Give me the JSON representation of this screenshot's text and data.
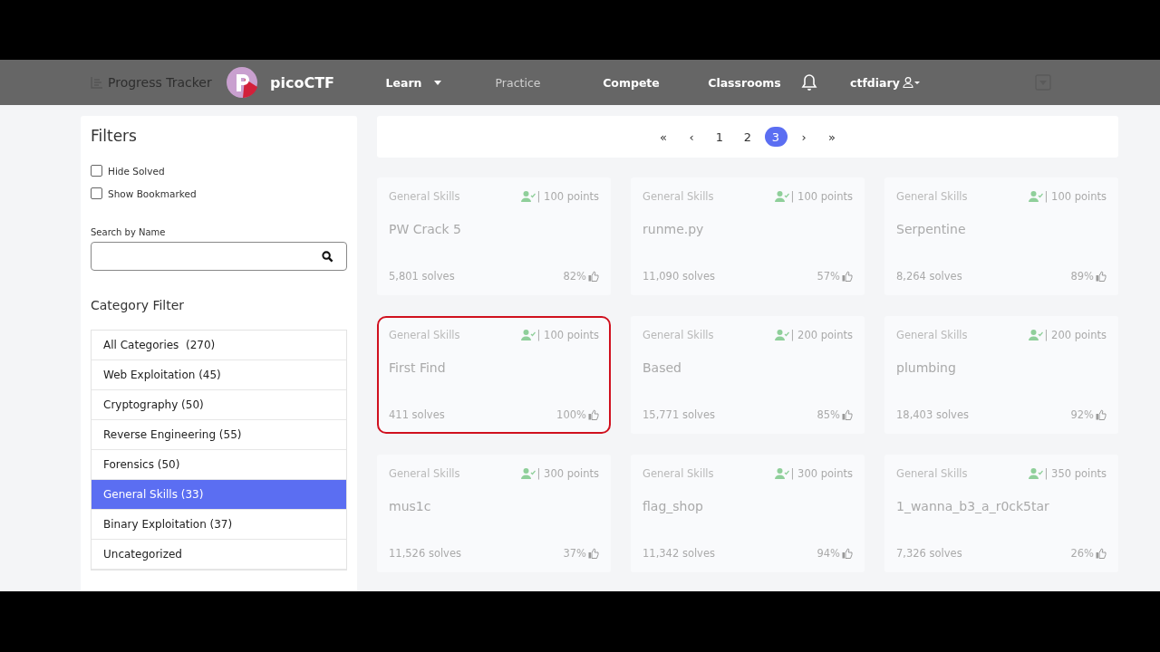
{
  "header": {
    "progress_tracker": "Progress Tracker",
    "brand": "picoCTF",
    "nav": [
      {
        "label": "Learn",
        "dropdown": true,
        "selected": false
      },
      {
        "label": "Practice",
        "dropdown": false,
        "selected": true
      },
      {
        "label": "Compete",
        "dropdown": false,
        "selected": false
      },
      {
        "label": "Classrooms",
        "dropdown": false,
        "selected": false
      }
    ],
    "user": "ctfdiary"
  },
  "filters": {
    "title": "Filters",
    "checkboxes": [
      {
        "label": "Hide Solved",
        "checked": false
      },
      {
        "label": "Show Bookmarked",
        "checked": false
      }
    ],
    "search_label": "Search by Name",
    "category_title": "Category Filter",
    "categories": [
      {
        "label": "All Categories  (270)",
        "selected": false
      },
      {
        "label": "Web Exploitation (45)",
        "selected": false
      },
      {
        "label": "Cryptography (50)",
        "selected": false
      },
      {
        "label": "Reverse Engineering (55)",
        "selected": false
      },
      {
        "label": "Forensics (50)",
        "selected": false
      },
      {
        "label": "General Skills (33)",
        "selected": true
      },
      {
        "label": "Binary Exploitation (37)",
        "selected": false
      },
      {
        "label": "Uncategorized",
        "selected": false
      }
    ]
  },
  "pagination": [
    {
      "label": "«",
      "selected": false
    },
    {
      "label": "‹",
      "selected": false
    },
    {
      "label": "1",
      "selected": false
    },
    {
      "label": "2",
      "selected": false
    },
    {
      "label": "3",
      "selected": true
    },
    {
      "label": "›",
      "selected": false
    },
    {
      "label": "»",
      "selected": false
    }
  ],
  "challenges": [
    {
      "category": "General Skills",
      "points": "| 100 points",
      "name": "PW Crack 5",
      "solves": "5,801 solves",
      "rating": "82%",
      "highlighted": false
    },
    {
      "category": "General Skills",
      "points": "| 100 points",
      "name": "runme.py",
      "solves": "11,090 solves",
      "rating": "57%",
      "highlighted": false
    },
    {
      "category": "General Skills",
      "points": "| 100 points",
      "name": "Serpentine",
      "solves": "8,264 solves",
      "rating": "89%",
      "highlighted": false
    },
    {
      "category": "General Skills",
      "points": "| 100 points",
      "name": "First Find",
      "solves": "411 solves",
      "rating": "100%",
      "highlighted": true
    },
    {
      "category": "General Skills",
      "points": "| 200 points",
      "name": "Based",
      "solves": "15,771 solves",
      "rating": "85%",
      "highlighted": false
    },
    {
      "category": "General Skills",
      "points": "| 200 points",
      "name": "plumbing",
      "solves": "18,403 solves",
      "rating": "92%",
      "highlighted": false
    },
    {
      "category": "General Skills",
      "points": "| 300 points",
      "name": "mus1c",
      "solves": "11,526 solves",
      "rating": "37%",
      "highlighted": false
    },
    {
      "category": "General Skills",
      "points": "| 300 points",
      "name": "flag_shop",
      "solves": "11,342 solves",
      "rating": "94%",
      "highlighted": false
    },
    {
      "category": "General Skills",
      "points": "| 350 points",
      "name": "1_wanna_b3_a_r0ck5tar",
      "solves": "7,326 solves",
      "rating": "26%",
      "highlighted": false
    }
  ]
}
